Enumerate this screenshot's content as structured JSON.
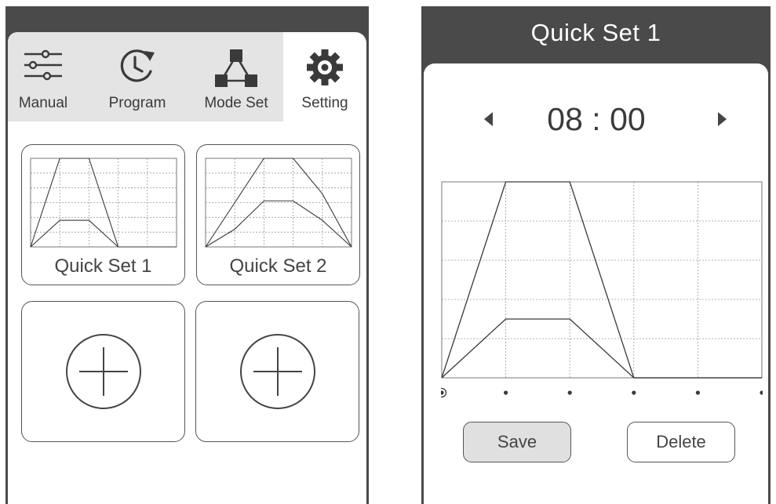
{
  "left": {
    "tabs": [
      {
        "label": "Manual",
        "icon": "sliders-icon"
      },
      {
        "label": "Program",
        "icon": "clock-refresh-icon"
      },
      {
        "label": "Mode Set",
        "icon": "network-icon"
      },
      {
        "label": "Setting",
        "icon": "gear-icon"
      }
    ],
    "cards": [
      {
        "label": "Quick Set 1"
      },
      {
        "label": "Quick Set 2"
      }
    ],
    "add_icons": [
      "add-circle-icon",
      "add-circle-icon"
    ]
  },
  "right": {
    "title": "Quick Set 1",
    "time": "08 : 00",
    "save_label": "Save",
    "delete_label": "Delete"
  },
  "chart_data": [
    {
      "name": "quick-set-1-detail",
      "type": "line",
      "x": [
        0,
        1,
        2,
        3,
        4,
        5
      ],
      "ylim": [
        0,
        5
      ],
      "grid": true,
      "selected_point": 0,
      "series": [
        {
          "values": [
            0,
            5,
            5,
            0,
            0,
            0
          ]
        },
        {
          "values": [
            0,
            1.5,
            1.5,
            0,
            0,
            0
          ]
        }
      ]
    },
    {
      "name": "quick-set-1-thumb",
      "type": "line",
      "x": [
        0,
        1,
        2,
        3,
        4,
        5
      ],
      "ylim": [
        0,
        5
      ],
      "grid": true,
      "series": [
        {
          "values": [
            0,
            5,
            5,
            0,
            0,
            0
          ]
        },
        {
          "values": [
            0,
            1.5,
            1.5,
            0,
            0,
            0
          ]
        }
      ]
    },
    {
      "name": "quick-set-2-thumb",
      "type": "line",
      "x": [
        0,
        1,
        2,
        3,
        4,
        5
      ],
      "ylim": [
        0,
        5
      ],
      "grid": true,
      "series": [
        {
          "values": [
            0,
            2.5,
            5,
            5,
            3,
            0
          ]
        },
        {
          "values": [
            0,
            1,
            2.6,
            2.6,
            1.5,
            0
          ]
        }
      ]
    }
  ]
}
